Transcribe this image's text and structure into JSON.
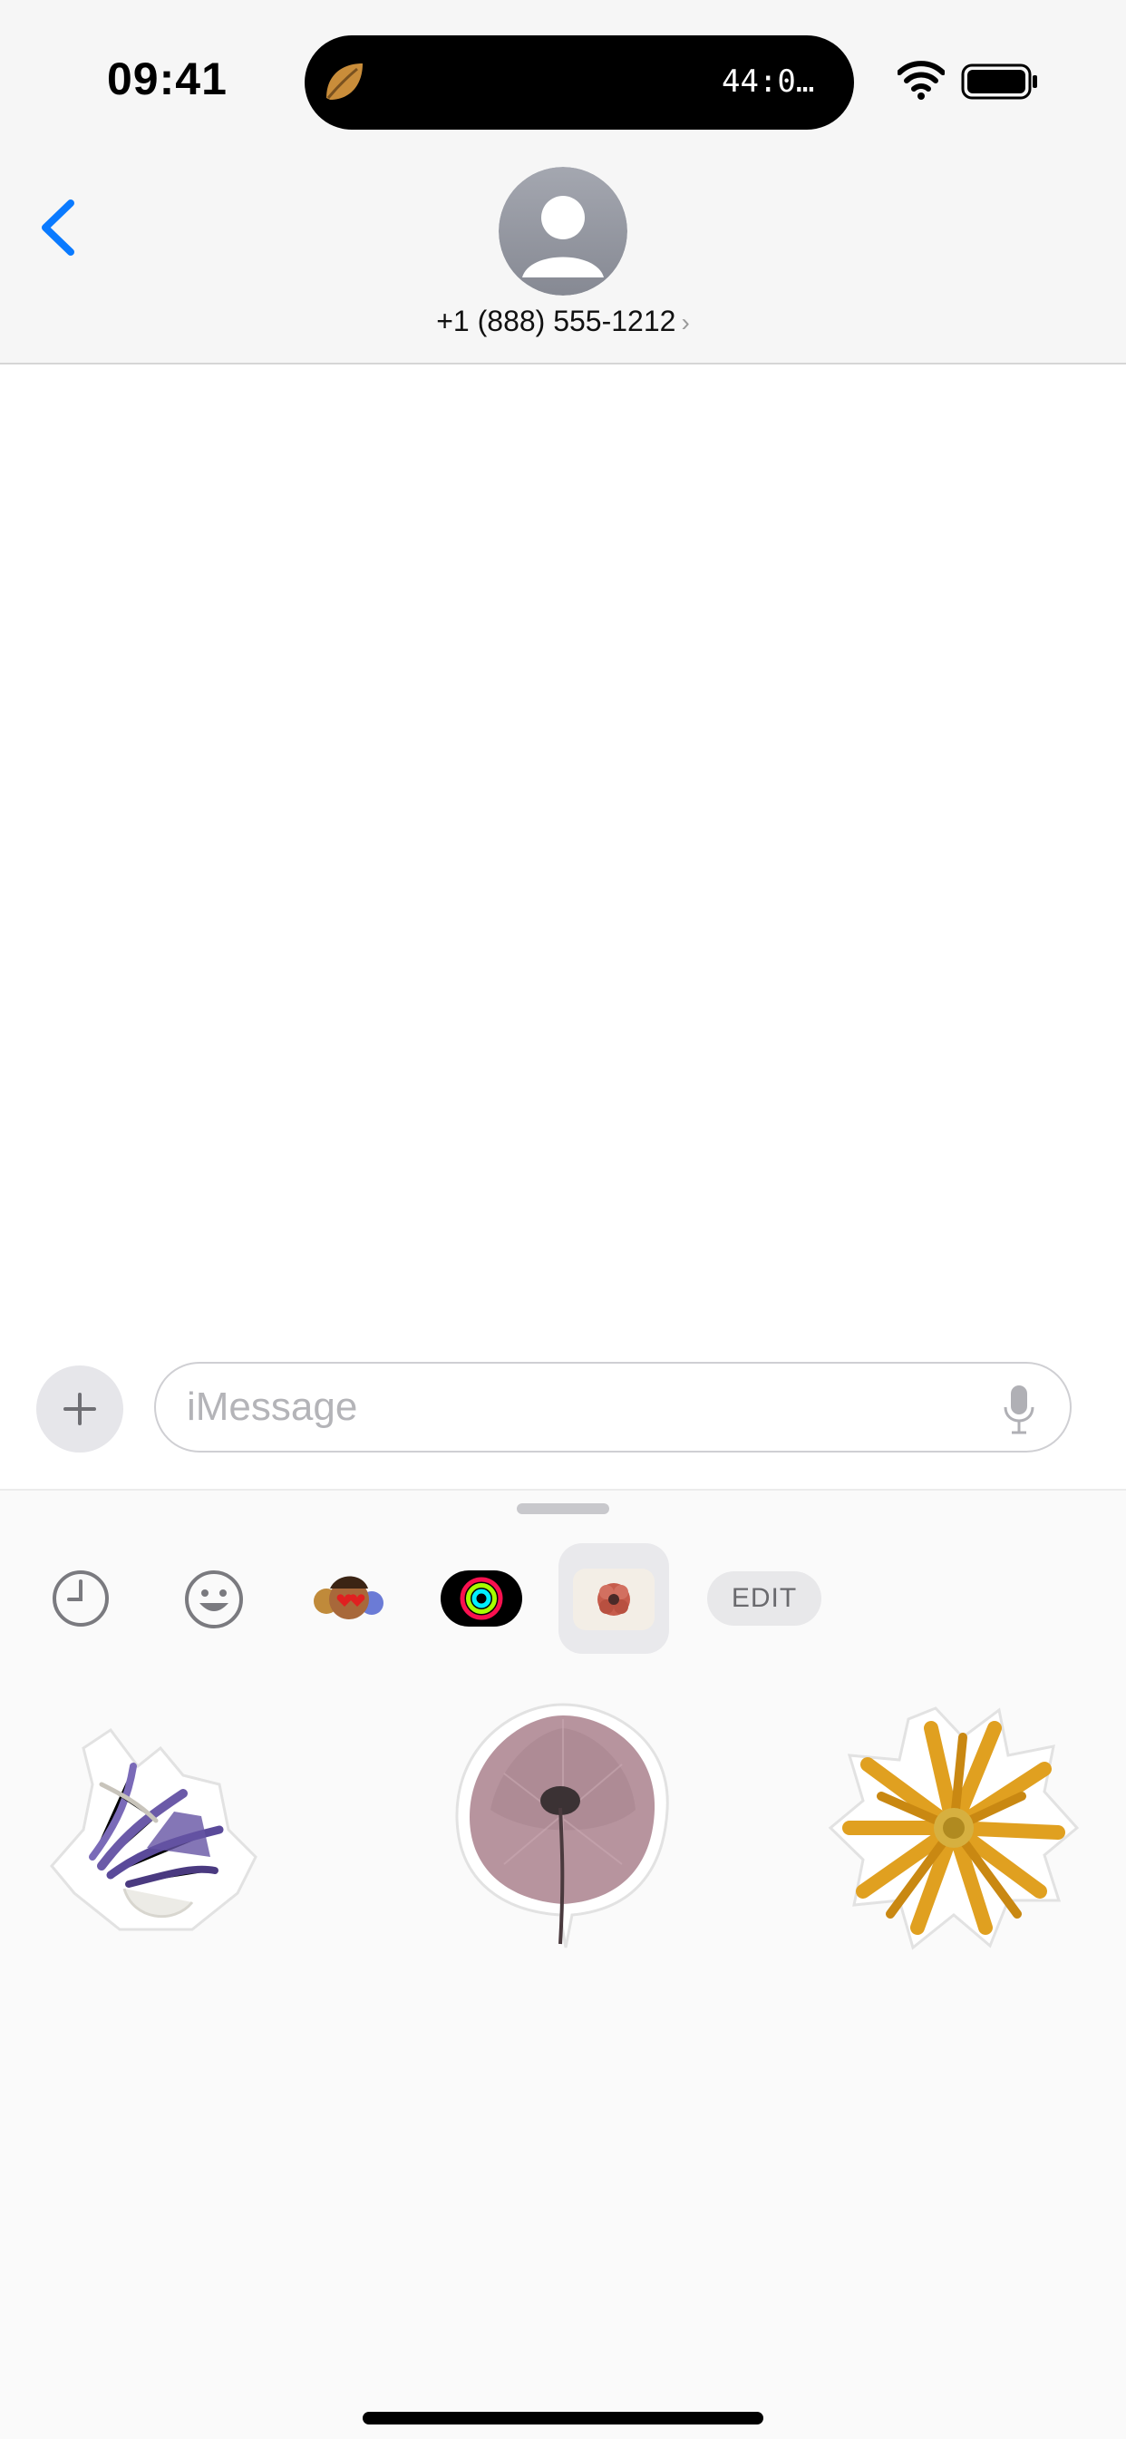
{
  "status_bar": {
    "time": "09:41",
    "live_activity_timer": "44:0…",
    "icons": [
      "leaf-icon",
      "wifi-icon",
      "battery-icon"
    ]
  },
  "header": {
    "back_icon": "chevron-left-icon",
    "contact_name": "+1 (888) 555-1212",
    "contact_chevron": "›",
    "avatar_icon": "person-silhouette-icon"
  },
  "composer": {
    "add_icon": "plus-icon",
    "placeholder": "iMessage",
    "mic_icon": "microphone-icon"
  },
  "app_tray": {
    "items": [
      {
        "name": "recents",
        "icon": "clock-icon"
      },
      {
        "name": "emoji",
        "icon": "smiley-icon"
      },
      {
        "name": "memoji",
        "icon": "memoji-icon"
      },
      {
        "name": "activity",
        "icon": "activity-rings-icon"
      },
      {
        "name": "stickers",
        "icon": "flower-sticker-icon",
        "selected": true
      }
    ],
    "edit_label": "EDIT"
  },
  "stickers": [
    {
      "name": "purple-pressed-flower",
      "color": "#6b5aa8"
    },
    {
      "name": "pink-pressed-poppy",
      "color": "#b7949e"
    },
    {
      "name": "yellow-pressed-daisy",
      "color": "#e0a020"
    }
  ],
  "colors": {
    "accent": "#0a7aff",
    "header_bg": "#f6f6f6",
    "drawer_bg": "#fafafa"
  }
}
